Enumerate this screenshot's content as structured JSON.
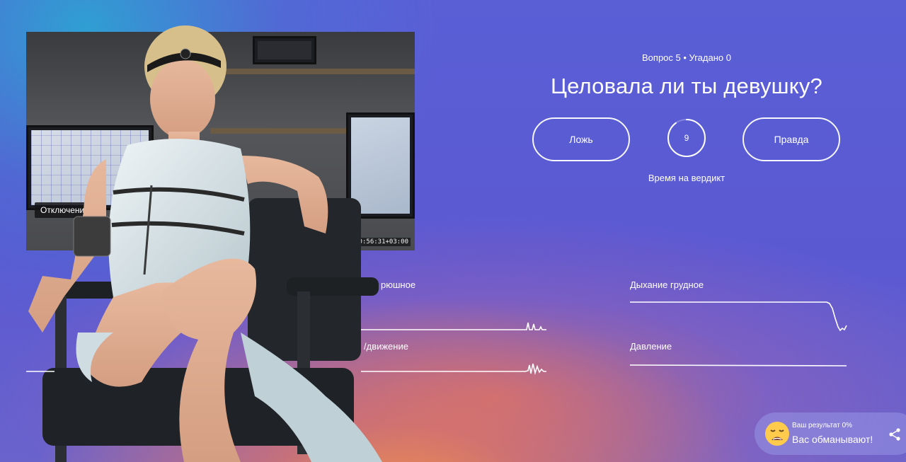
{
  "video": {
    "caption": "Отключени",
    "timestamp": "20:56:31+03:00"
  },
  "quiz": {
    "progress": "Вопрос 5 • Угадано 0",
    "question": "Целовала ли ты девушку?",
    "false_label": "Ложь",
    "true_label": "Правда",
    "timer_value": "9",
    "timer_fraction": 0.9,
    "timer_label": "Время на вердикт"
  },
  "signals": {
    "left_top_label": "рюшное",
    "left_bottom_label": "/движение",
    "right_top_label": "Дыхание грудное",
    "right_bottom_label": "Давление"
  },
  "result": {
    "label": "Ваш результат 0%",
    "verdict": "Вас обманывают!",
    "emoji": "weary-face-icon"
  },
  "colors": {
    "accent": "#ffffff",
    "bg_top": "#5a5fd6",
    "bg_warm": "#ff9a3c"
  }
}
